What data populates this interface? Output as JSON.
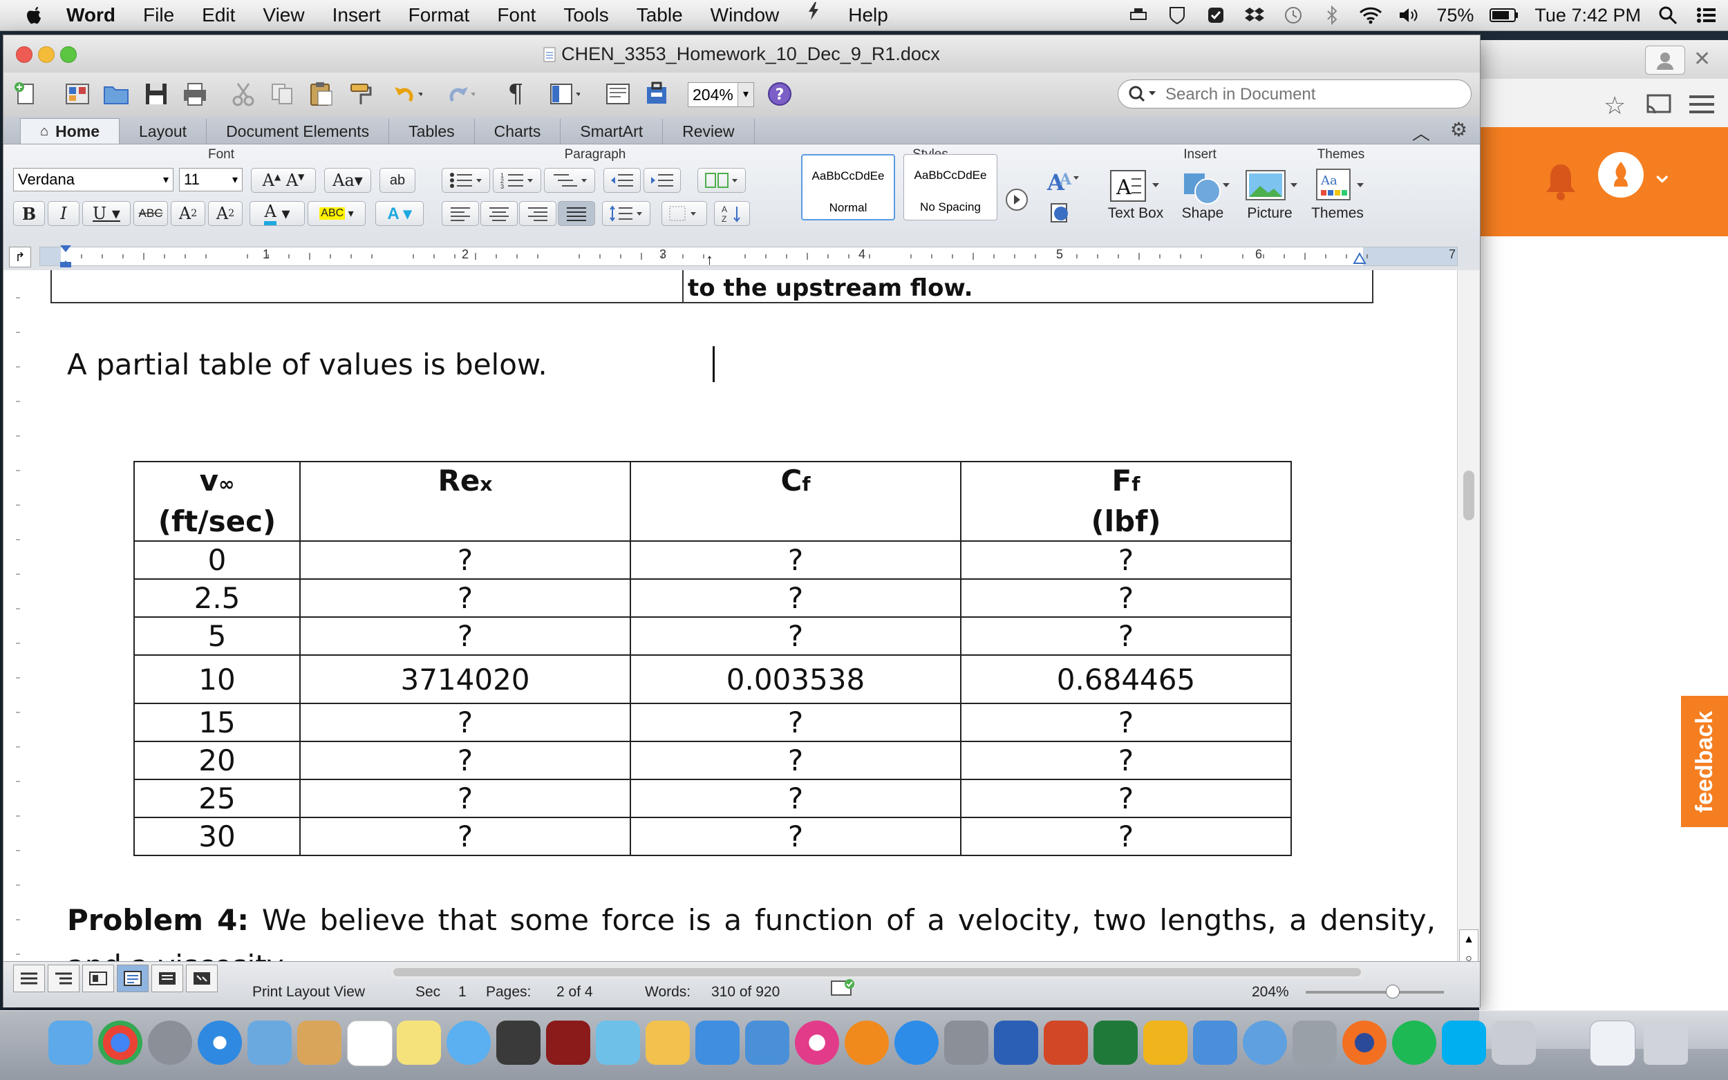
{
  "menubar": {
    "app": "Word",
    "items": [
      "File",
      "Edit",
      "View",
      "Insert",
      "Format",
      "Font",
      "Tools",
      "Table",
      "Window",
      "Help"
    ],
    "battery": "75%",
    "clock": "Tue 7:42 PM"
  },
  "window": {
    "title": "CHEN_3353_Homework_10_Dec_9_R1.docx"
  },
  "toolbar": {
    "zoom": "204%",
    "search_placeholder": "Search in Document"
  },
  "tabs": [
    "Home",
    "Layout",
    "Document Elements",
    "Tables",
    "Charts",
    "SmartArt",
    "Review"
  ],
  "ribbon": {
    "groups": {
      "font": "Font",
      "paragraph": "Paragraph",
      "styles": "Styles",
      "insert": "Insert",
      "themes": "Themes"
    },
    "font_name": "Verdana",
    "font_size": "11",
    "styles": [
      {
        "preview": "AaBbCcDdEe",
        "name": "Normal"
      },
      {
        "preview": "AaBbCcDdEe",
        "name": "No Spacing"
      }
    ],
    "insert": {
      "text_box": "Text Box",
      "shape": "Shape",
      "picture": "Picture"
    },
    "themes_label": "Themes",
    "ruler_numbers": [
      "1",
      "2",
      "3",
      "4",
      "5",
      "6",
      "7"
    ]
  },
  "document": {
    "prev_cell": "to the upstream flow.",
    "para": "A partial table of values is below.",
    "table": {
      "headers": [
        {
          "main": "v",
          "sub": "∞",
          "line2": "(ft/sec)"
        },
        {
          "main": "Re",
          "sub": "x",
          "line2": ""
        },
        {
          "main": "C",
          "sub": "f",
          "line2": ""
        },
        {
          "main": "F",
          "sub": "f",
          "line2": "(lbf)"
        }
      ],
      "rows": [
        [
          "0",
          "?",
          "?",
          "?"
        ],
        [
          "2.5",
          "?",
          "?",
          "?"
        ],
        [
          "5",
          "?",
          "?",
          "?"
        ],
        [
          "10",
          "3714020",
          "0.003538",
          "0.684465"
        ],
        [
          "15",
          "?",
          "?",
          "?"
        ],
        [
          "20",
          "?",
          "?",
          "?"
        ],
        [
          "25",
          "?",
          "?",
          "?"
        ],
        [
          "30",
          "?",
          "?",
          "?"
        ]
      ]
    },
    "problem_label": "Problem 4:",
    "problem_text": " We believe that some force is a function of a velocity, two lengths, a density, and a viscosity."
  },
  "statusbar": {
    "view": "Print Layout View",
    "sec_label": "Sec",
    "sec": "1",
    "pages_label": "Pages:",
    "pages": "2 of 4",
    "words_label": "Words:",
    "words": "310 of 920",
    "zoom": "204%"
  },
  "feedback": "feedback",
  "colors": {
    "orange": "#f57e20",
    "ribbon": "#e4e7ec"
  }
}
